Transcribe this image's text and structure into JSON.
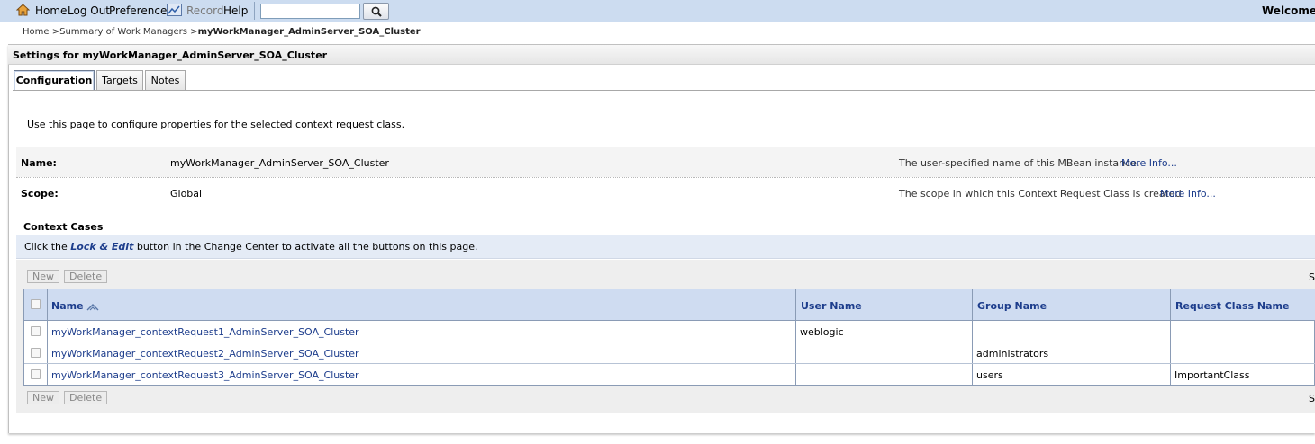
{
  "toolbar": {
    "home": "Home",
    "logout": "Log Out",
    "preferences": "Preferences",
    "record": "Record",
    "help": "Help",
    "search_value": "",
    "welcome": "Welcome, "
  },
  "breadcrumb": {
    "home": "Home",
    "sep": ">",
    "summary": "Summary of Work Managers",
    "current": "myWorkManager_AdminServer_SOA_Cluster"
  },
  "page": {
    "title": "Settings for myWorkManager_AdminServer_SOA_Cluster",
    "intro": "Use this page to configure properties for the selected context request class."
  },
  "tabs": [
    "Configuration",
    "Targets",
    "Notes"
  ],
  "properties": {
    "name": {
      "label": "Name:",
      "value": "myWorkManager_AdminServer_SOA_Cluster",
      "help": "The user-specified name of this MBean instance.",
      "more": "More Info..."
    },
    "scope": {
      "label": "Scope:",
      "value": "Global",
      "help": "The scope in which this Context Request Class is created.",
      "more": "More Info..."
    }
  },
  "context_cases": {
    "title": "Context Cases",
    "notice_pre": "Click the ",
    "notice_em": "Lock & Edit",
    "notice_post": " button in the Change Center to activate all the buttons on this page.",
    "new_label": "New",
    "delete_label": "Delete",
    "right_fragment": "S",
    "columns": [
      "Name",
      "User Name",
      "Group Name",
      "Request Class Name"
    ],
    "rows": [
      {
        "name": "myWorkManager_contextRequest1_AdminServer_SOA_Cluster",
        "user": "weblogic",
        "group": "",
        "request_class": ""
      },
      {
        "name": "myWorkManager_contextRequest2_AdminServer_SOA_Cluster",
        "user": "",
        "group": "administrators",
        "request_class": ""
      },
      {
        "name": "myWorkManager_contextRequest3_AdminServer_SOA_Cluster",
        "user": "",
        "group": "users",
        "request_class": "ImportantClass"
      }
    ]
  },
  "colors": {
    "toolbar_bg": "#ccdcf0",
    "link": "#1d3d8c",
    "header_bg": "#cfdcf1"
  }
}
